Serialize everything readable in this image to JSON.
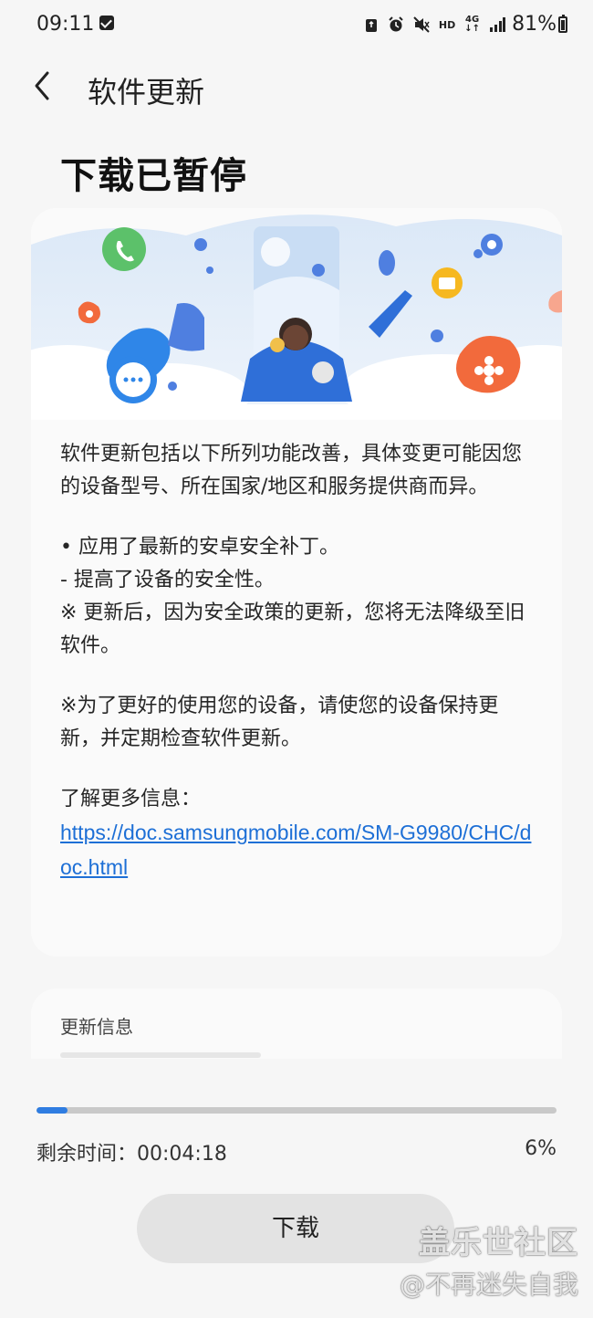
{
  "status_bar": {
    "time": "09:11",
    "hd_label": "HD",
    "network_label": "4G",
    "battery": "81%"
  },
  "app_bar": {
    "title": "软件更新",
    "back_icon": "chevron-left-icon"
  },
  "main_title": "下载已暂停",
  "description": {
    "para1": "软件更新包括以下所列功能改善，具体变更可能因您的设备型号、所在国家/地区和服务提供商而异。",
    "bullet1": "• 应用了最新的安卓安全补丁。",
    "bullet2": " - 提高了设备的安全性。",
    "note1": "※ 更新后，因为安全政策的更新，您将无法降级至旧软件。",
    "note2": "※为了更好的使用您的设备，请使您的设备保持更新，并定期检查软件更新。",
    "learn_more_label": "了解更多信息：",
    "link": "https://doc.samsungmobile.com/SM-G9980/CHC/doc.html"
  },
  "info_section": {
    "title": "更新信息"
  },
  "progress": {
    "percent_value": 0.06,
    "remaining_label": "剩余时间：",
    "remaining_time": "00:04:18",
    "percent_text": "6%"
  },
  "download_button": {
    "label": "下载"
  },
  "watermark": {
    "line1": "盖乐世社区",
    "line2": "@不再迷失自我"
  },
  "colors": {
    "accent": "#2f7de1",
    "link": "#1d6fd6",
    "background": "#f6f6f6"
  }
}
